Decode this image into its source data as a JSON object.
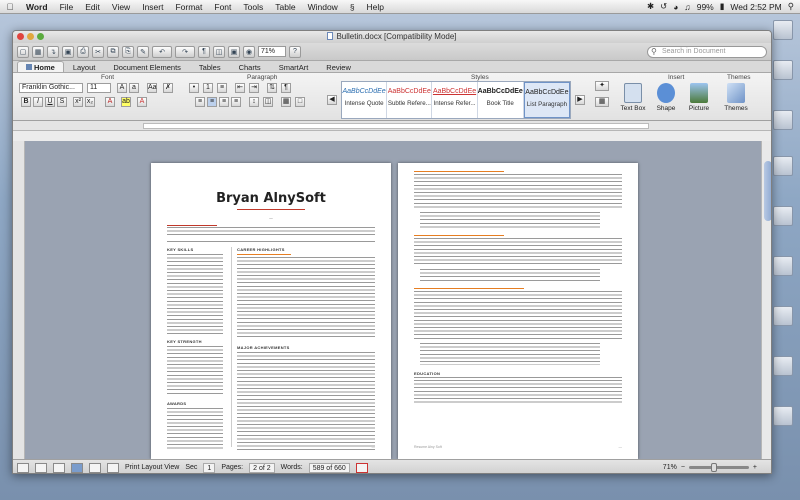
{
  "menubar": {
    "app": "Word",
    "items": [
      "File",
      "Edit",
      "View",
      "Insert",
      "Format",
      "Font",
      "Tools",
      "Table",
      "Window",
      "Help"
    ],
    "battery": "99%",
    "clock": "Wed 2:52 PM"
  },
  "window": {
    "title": "Bulletin.docx [Compatibility Mode]",
    "zoom": "71%",
    "search_placeholder": "Search in Document"
  },
  "ribbon_tabs": [
    "Home",
    "Layout",
    "Document Elements",
    "Tables",
    "Charts",
    "SmartArt",
    "Review"
  ],
  "ribbon": {
    "groups": {
      "font": "Font",
      "paragraph": "Paragraph",
      "styles": "Styles",
      "insert": "Insert",
      "themes": "Themes"
    },
    "font_name": "Franklin Gothic...",
    "font_size": "11",
    "style_sample": "AaBbCcDdEe",
    "styles": [
      "Intense Quote",
      "Subtle Refere...",
      "Intense Refer...",
      "Book Title",
      "List Paragraph"
    ],
    "insert_items": [
      "Text Box",
      "Shape",
      "Picture"
    ],
    "themes_label": "Themes"
  },
  "resume": {
    "name": "Bryan AlnySoft",
    "sections_left": [
      "KEY SKILLS",
      "KEY STRENGTH",
      "AWARDS"
    ],
    "sections_right": [
      "CAREER HIGHLIGHTS",
      "MAJOR ACHIEVEMENTS"
    ],
    "page2_section": "EDUCATION",
    "footer_name": "Resume Alny Soft"
  },
  "status": {
    "view": "Print Layout View",
    "sec_label": "Sec",
    "sec_value": "1",
    "pages_label": "Pages:",
    "pages_value": "2 of 2",
    "words_label": "Words:",
    "words_value": "589 of 660",
    "zoom": "71%"
  },
  "colors": {
    "accent": "#c0392b",
    "orange": "#e67e22",
    "ribbon_select": "#dde7f6"
  }
}
